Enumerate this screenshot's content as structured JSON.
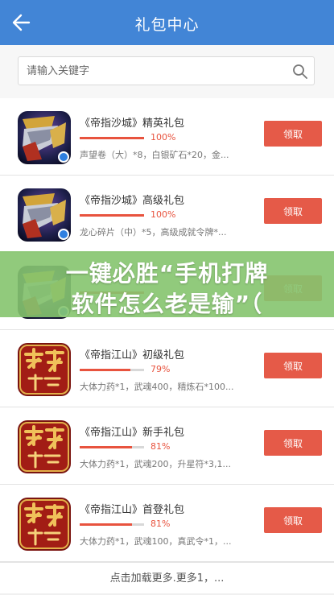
{
  "header": {
    "title": "礼包中心",
    "back_icon": "arrow-left-icon"
  },
  "search": {
    "placeholder": "请输入关键字",
    "value": "",
    "icon": "search-icon"
  },
  "packs": [
    {
      "game": "sha",
      "title": "《帝指沙城》精英礼包",
      "percent": "100%",
      "progress": 1.0,
      "contents": "声望卷（大）*8，白银矿石*20，金...",
      "button": "领取",
      "badge": true
    },
    {
      "game": "sha",
      "title": "《帝指沙城》高级礼包",
      "percent": "100%",
      "progress": 1.0,
      "contents": "龙心碎片（中）*5，高级成就令牌*...",
      "button": "领取",
      "badge": true
    },
    {
      "game": "sha",
      "title": "",
      "percent": "",
      "progress": 1.0,
      "contents": "",
      "button": "领取",
      "badge": true
    },
    {
      "game": "jiang",
      "title": "《帝指江山》初级礼包",
      "percent": "79%",
      "progress": 0.79,
      "contents": "大体力药*1，武魂400，精炼石*100...",
      "button": "领取",
      "badge": false
    },
    {
      "game": "jiang",
      "title": "《帝指江山》新手礼包",
      "percent": "81%",
      "progress": 0.81,
      "contents": "大体力药*1，武魂200，升星符*3,1...",
      "button": "领取",
      "badge": false
    },
    {
      "game": "jiang",
      "title": "《帝指江山》首登礼包",
      "percent": "81%",
      "progress": 0.81,
      "contents": "大体力药*1，武魂100，真武令*1，...",
      "button": "领取",
      "badge": false
    }
  ],
  "footer": {
    "more": "点击加载更多.更多1，..."
  },
  "banner": {
    "line1": "一键必胜“手机打牌",
    "line2": "软件怎么老是输”（"
  },
  "colors": {
    "header": "#4285d6",
    "accent": "#e55a48",
    "banner": "#85c46e"
  }
}
